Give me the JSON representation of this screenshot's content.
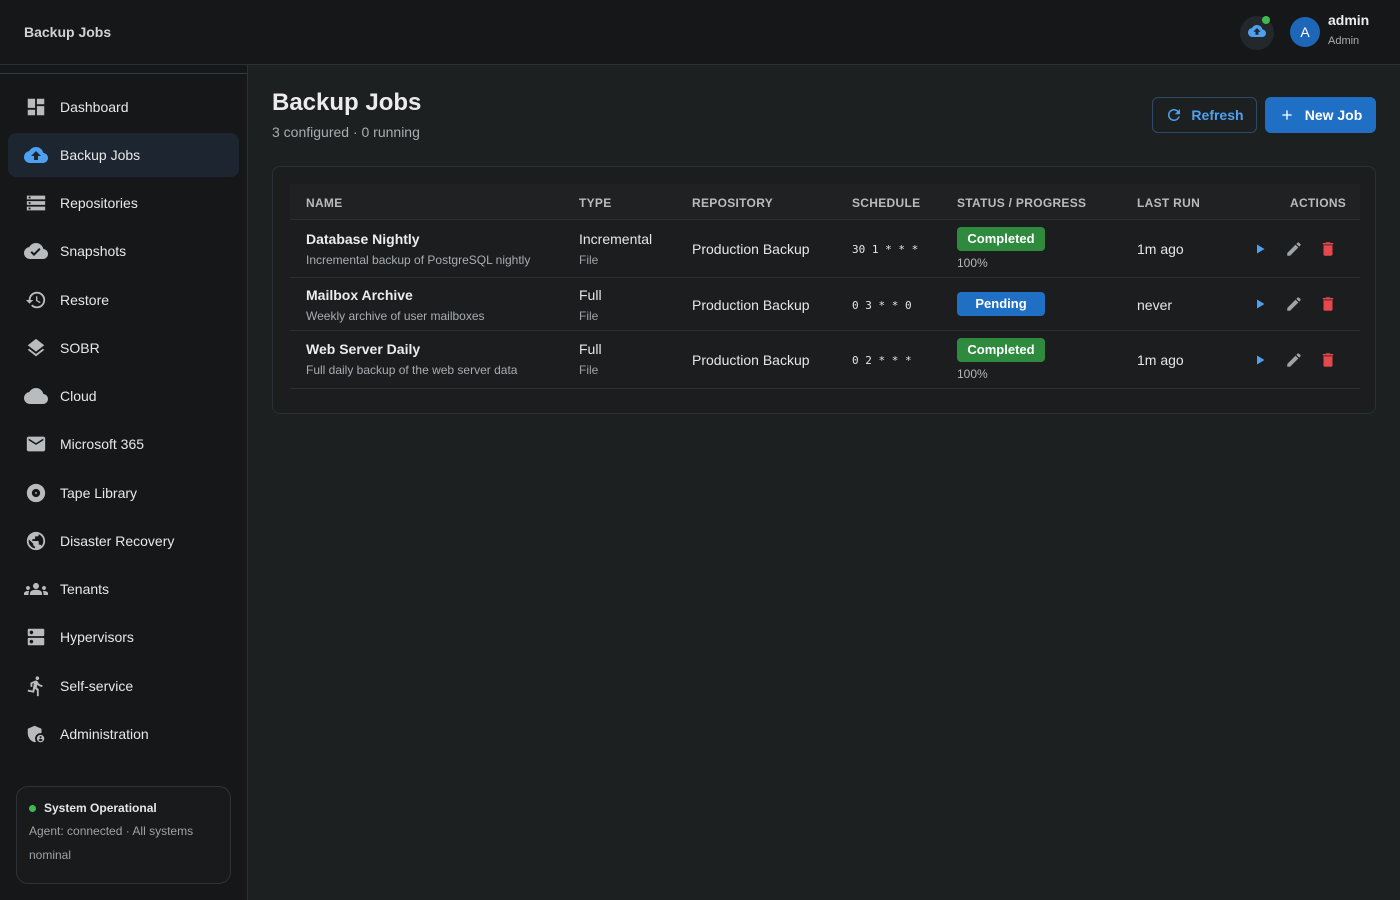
{
  "app": {
    "title": "Backup Jobs"
  },
  "user": {
    "name": "admin",
    "role": "Admin",
    "initial": "A"
  },
  "colors": {
    "accent": "#1f6fc5",
    "success": "#2e8b3e",
    "danger": "#e5484d",
    "online": "#3fb950"
  },
  "sidebar": {
    "items": [
      {
        "label": "Dashboard",
        "icon": "dashboard-icon",
        "active": false
      },
      {
        "label": "Backup Jobs",
        "icon": "cloud-upload-icon",
        "active": true
      },
      {
        "label": "Repositories",
        "icon": "storage-icon",
        "active": false
      },
      {
        "label": "Snapshots",
        "icon": "cloud-done-icon",
        "active": false
      },
      {
        "label": "Restore",
        "icon": "restore-icon",
        "active": false
      },
      {
        "label": "SOBR",
        "icon": "layers-icon",
        "active": false
      },
      {
        "label": "Cloud",
        "icon": "cloud-icon",
        "active": false
      },
      {
        "label": "Microsoft 365",
        "icon": "mail-icon",
        "active": false
      },
      {
        "label": "Tape Library",
        "icon": "tape-icon",
        "active": false
      },
      {
        "label": "Disaster Recovery",
        "icon": "globe-icon",
        "active": false
      },
      {
        "label": "Tenants",
        "icon": "groups-icon",
        "active": false
      },
      {
        "label": "Hypervisors",
        "icon": "server-icon",
        "active": false
      },
      {
        "label": "Self-service",
        "icon": "person-run-icon",
        "active": false
      },
      {
        "label": "Administration",
        "icon": "admin-shield-icon",
        "active": false
      }
    ],
    "status": {
      "title": "System Operational",
      "description": "Agent: connected · All systems nominal"
    }
  },
  "main": {
    "title": "Backup Jobs",
    "subtitle": "3 configured · 0 running",
    "refresh_label": "Refresh",
    "new_job_label": "New Job",
    "columns": [
      "NAME",
      "TYPE",
      "REPOSITORY",
      "SCHEDULE",
      "STATUS / PROGRESS",
      "LAST RUN",
      "ACTIONS"
    ],
    "jobs": [
      {
        "name": "Database Nightly",
        "description": "Incremental backup of PostgreSQL nightly",
        "type": "Incremental",
        "subtype": "File",
        "repository": "Production Backup",
        "schedule": "30 1 * * *",
        "status": "Completed",
        "progress": "100%",
        "last_run": "1m ago"
      },
      {
        "name": "Mailbox Archive",
        "description": "Weekly archive of user mailboxes",
        "type": "Full",
        "subtype": "File",
        "repository": "Production Backup",
        "schedule": "0 3 * * 0",
        "status": "Pending",
        "progress": "",
        "last_run": "never"
      },
      {
        "name": "Web Server Daily",
        "description": "Full daily backup of the web server data",
        "type": "Full",
        "subtype": "File",
        "repository": "Production Backup",
        "schedule": "0 2 * * *",
        "status": "Completed",
        "progress": "100%",
        "last_run": "1m ago"
      }
    ]
  }
}
